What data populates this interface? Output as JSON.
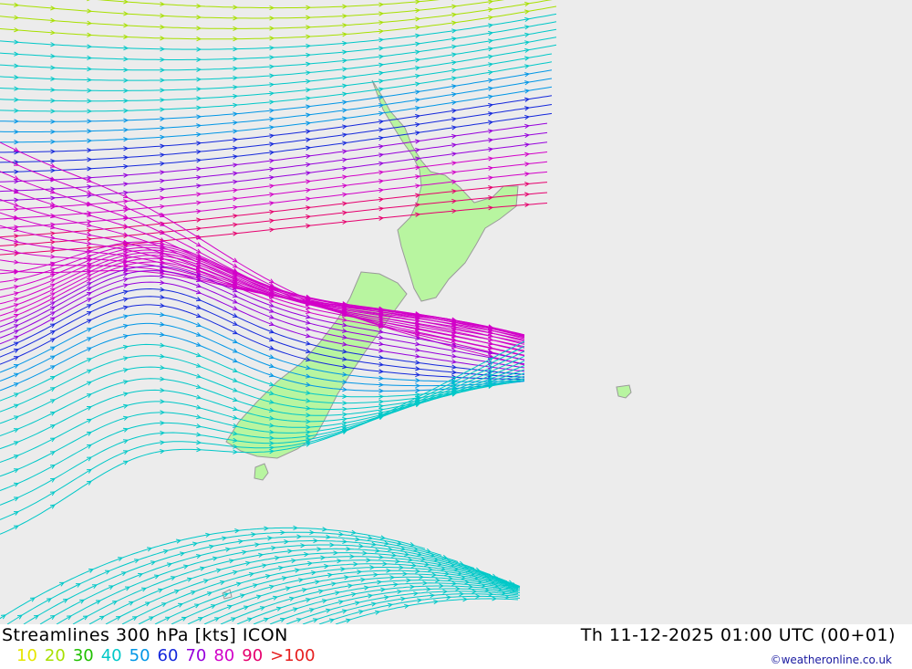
{
  "map": {
    "sea_color": "#ececec",
    "land_color": "#b8f5a0",
    "coast_color": "#9a9a9a"
  },
  "footer": {
    "title": "Streamlines 300 hPa [kts] ICON",
    "datetime": "Th 11-12-2025 01:00 UTC (00+01)",
    "credit": "©weatheronline.co.uk"
  },
  "legend": [
    {
      "label": "10",
      "color": "#e6e600"
    },
    {
      "label": "20",
      "color": "#a8e000"
    },
    {
      "label": "30",
      "color": "#20c000"
    },
    {
      "label": "40",
      "color": "#00c8c8"
    },
    {
      "label": "50",
      "color": "#0096e6"
    },
    {
      "label": "60",
      "color": "#1428dc"
    },
    {
      "label": "70",
      "color": "#9600dc"
    },
    {
      "label": "80",
      "color": "#d200c8"
    },
    {
      "label": "90",
      "color": "#e6006e"
    },
    {
      "label": ">100",
      "color": "#e61e1e"
    }
  ]
}
